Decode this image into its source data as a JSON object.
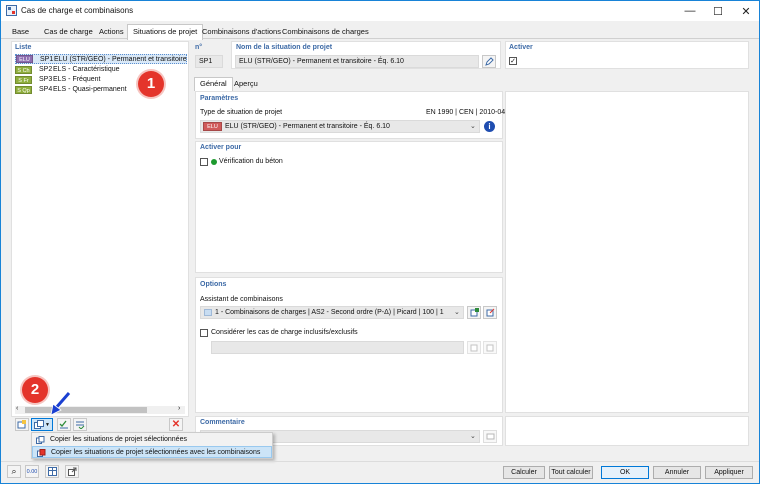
{
  "window": {
    "title": "Cas de charge et combinaisons",
    "minimize_glyph": "—",
    "maximize_glyph": "☐",
    "close_glyph": "✕"
  },
  "tabs": [
    {
      "label": "Base"
    },
    {
      "label": "Cas de charge"
    },
    {
      "label": "Actions"
    },
    {
      "label": "Situations de projet"
    },
    {
      "label": "Combinaisons d'actions"
    },
    {
      "label": "Combinaisons de charges"
    }
  ],
  "list": {
    "title": "Liste",
    "items": [
      {
        "badge": "ELU",
        "badge_color": "#8c6cb0",
        "id": "SP1",
        "label": "ELU (STR/GEO) - Permanent et transitoire - Éq",
        "selected": true
      },
      {
        "badge": "S Ch",
        "badge_color": "#8fae3c",
        "id": "SP2",
        "label": "ELS - Caractéristique"
      },
      {
        "badge": "S Fr",
        "badge_color": "#8fae3c",
        "id": "SP3",
        "label": "ELS - Fréquent"
      },
      {
        "badge": "S Qp",
        "badge_color": "#8fae3c",
        "id": "SP4",
        "label": "ELS - Quasi-permanent"
      }
    ]
  },
  "header": {
    "no_label": "n°",
    "no_value": "SP1",
    "name_label": "Nom de la situation de projet",
    "name_value": "ELU (STR/GEO) - Permanent et transitoire - Éq. 6.10",
    "activer_label": "Activer"
  },
  "subtabs": [
    {
      "label": "Général"
    },
    {
      "label": "Aperçu"
    }
  ],
  "parametres": {
    "title": "Paramètres",
    "type_label": "Type de situation de projet",
    "norm": "EN 1990 | CEN | 2010-04",
    "badge": "ELU",
    "type_value": "ELU (STR/GEO) - Permanent et transitoire - Éq. 6.10"
  },
  "activer_pour": {
    "title": "Activer pour",
    "item": "Vérification du béton"
  },
  "options": {
    "title": "Options",
    "assistant_label": "Assistant de combinaisons",
    "assistant_value": "1 - Combinaisons de charges | AS2 - Second ordre (P-Δ) | Picard | 100 | 1",
    "consider_label": "Considérer les cas de charge inclusifs/exclusifs"
  },
  "commentaire": {
    "title": "Commentaire"
  },
  "context_menu": {
    "items": [
      {
        "label": "Copier les situations de projet sélectionnées"
      },
      {
        "label": "Copier les situations de projet sélectionnées avec les combinaisons"
      }
    ]
  },
  "annotations": {
    "one": "1",
    "two": "2"
  },
  "footer": {
    "calculer": "Calculer",
    "tout_calculer": "Tout calculer",
    "ok": "OK",
    "annuler": "Annuler",
    "appliquer": "Appliquer"
  },
  "colors": {
    "accent": "#0078d7",
    "section_title": "#3d6aa6",
    "annotation_red": "#e4342b",
    "arrow_blue": "#1a3fd1"
  }
}
